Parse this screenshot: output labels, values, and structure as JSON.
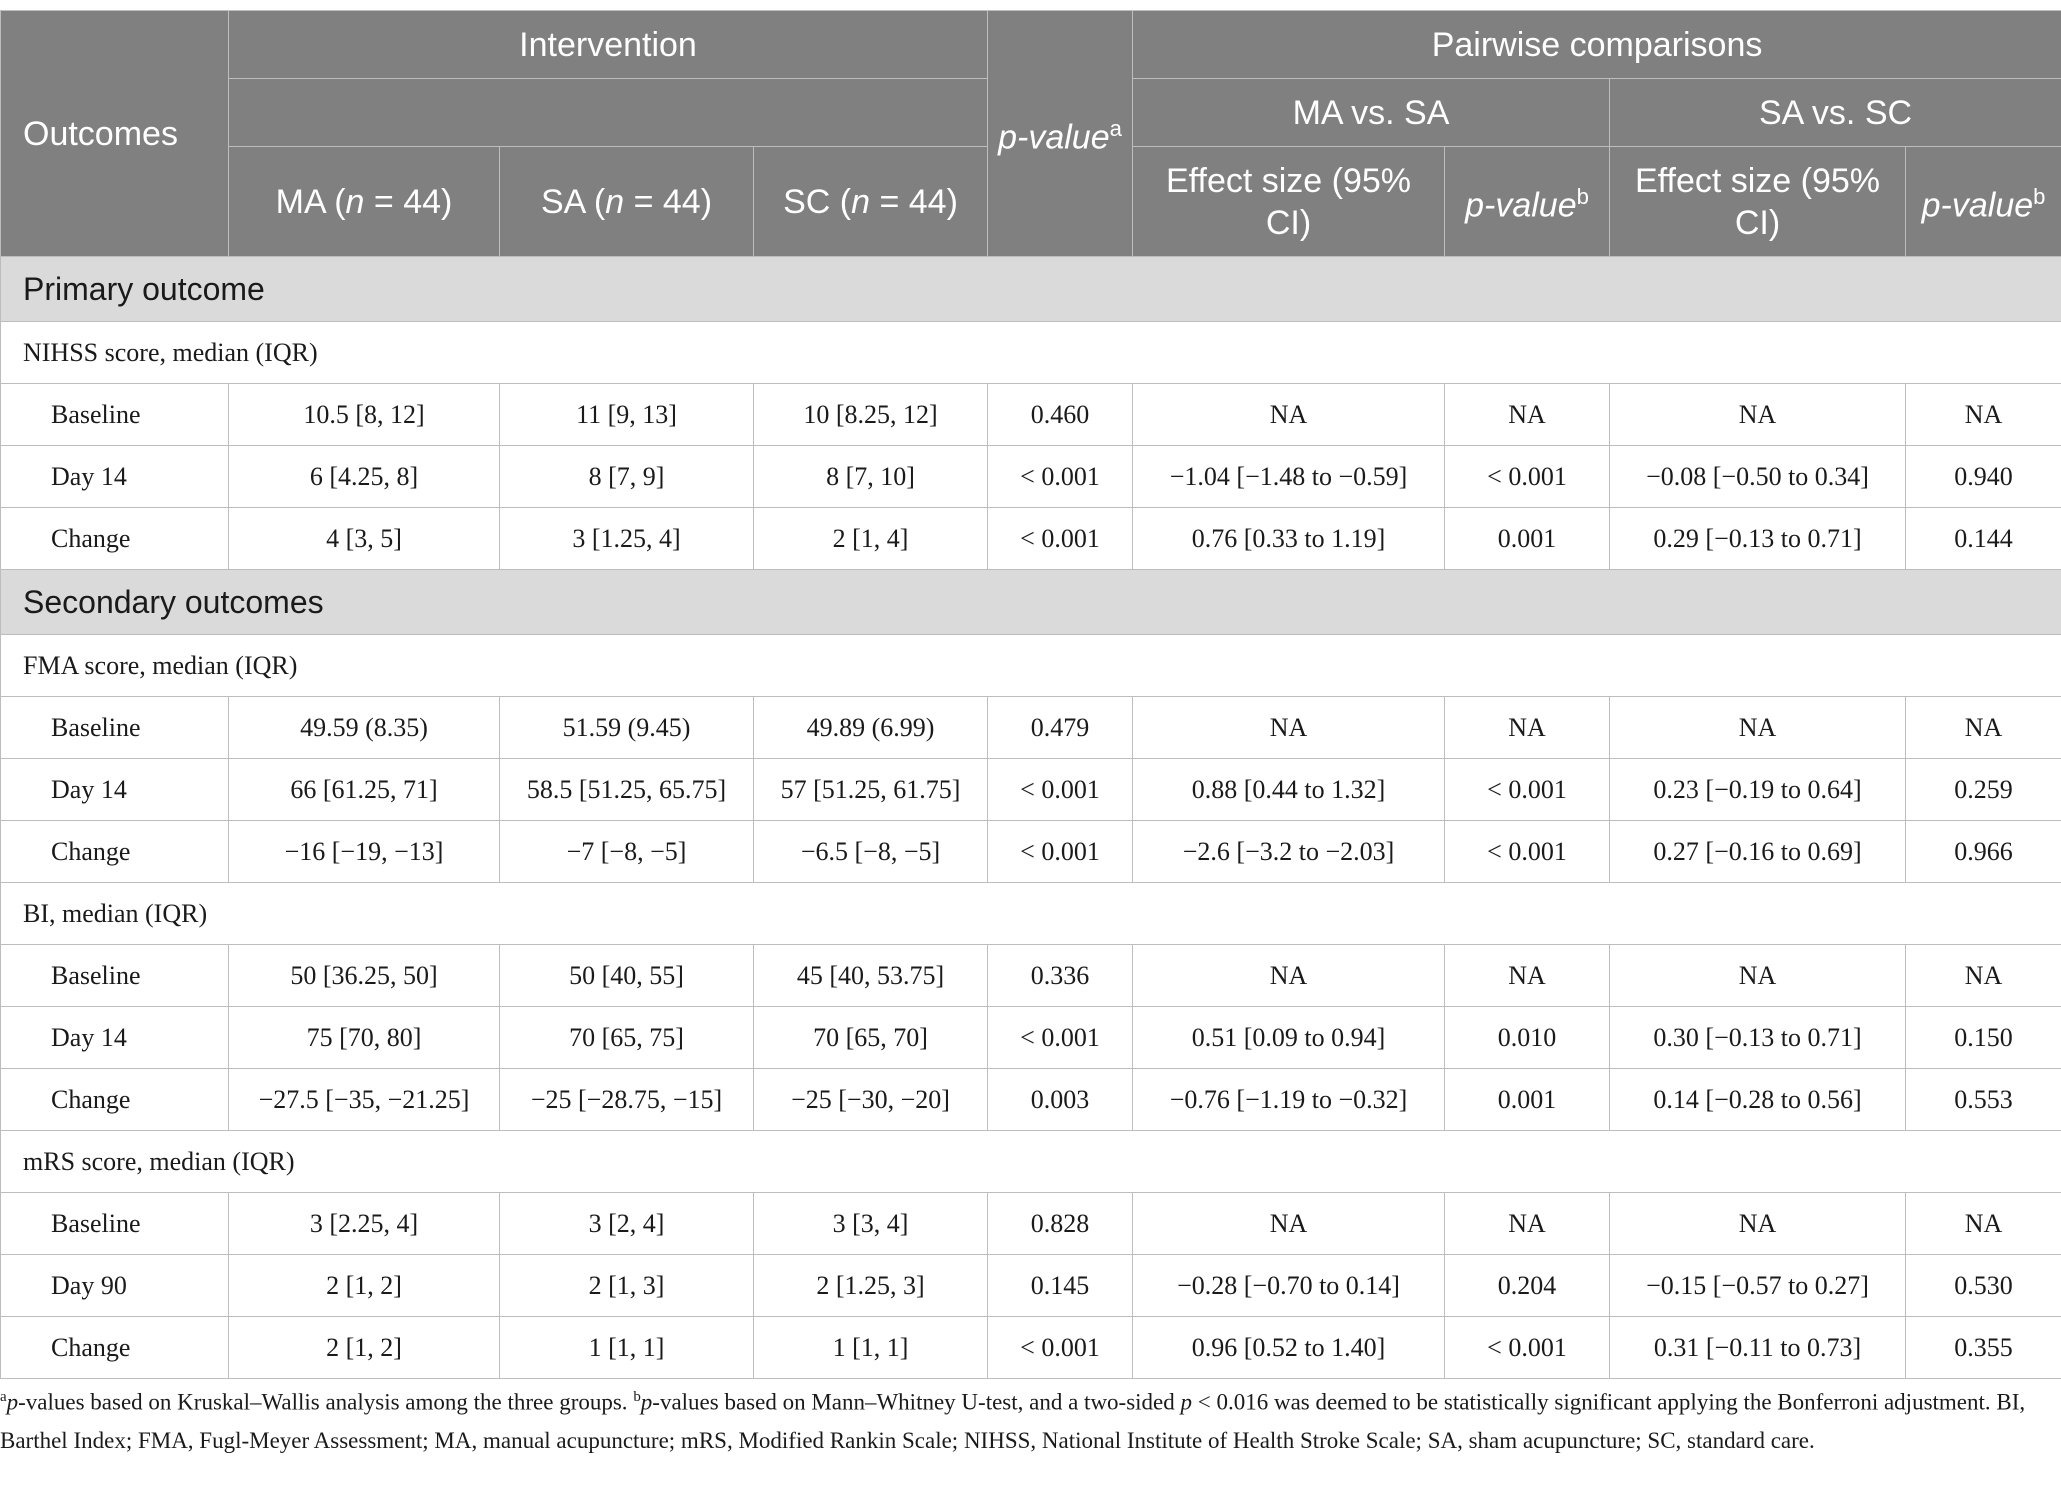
{
  "header": {
    "outcomes": "Outcomes",
    "intervention": "Intervention",
    "pvalue_a_text": "p-value",
    "pvalue_a_sup": "a",
    "pairwise": "Pairwise comparisons",
    "ma_vs_sa": "MA vs. SA",
    "sa_vs_sc": "SA vs. SC",
    "ma_col": {
      "name": "MA (",
      "n": "n",
      "rest": " = 44)"
    },
    "sa_col": {
      "name": "SA (",
      "n": "n",
      "rest": " = 44)"
    },
    "sc_col": {
      "name": "SC (",
      "n": "n",
      "rest": " = 44)"
    },
    "effect_size": "Effect size (95% CI)",
    "pvalue_b_text": "p-value",
    "pvalue_b_sup": "b"
  },
  "sections": {
    "primary": "Primary outcome",
    "secondary": "Secondary outcomes"
  },
  "groups": {
    "nihss": "NIHSS score, median (IQR)",
    "fma": "FMA score, median (IQR)",
    "bi": "BI, median (IQR)",
    "mrs": "mRS score, median (IQR)"
  },
  "rows": {
    "nihss": [
      [
        "Baseline",
        "10.5 [8, 12]",
        "11 [9, 13]",
        "10 [8.25, 12]",
        "0.460",
        "NA",
        "NA",
        "NA",
        "NA"
      ],
      [
        "Day 14",
        "6 [4.25, 8]",
        "8 [7, 9]",
        "8 [7, 10]",
        "< 0.001",
        "−1.04 [−1.48 to −0.59]",
        "< 0.001",
        "−0.08 [−0.50 to 0.34]",
        "0.940"
      ],
      [
        "Change",
        "4 [3, 5]",
        "3 [1.25, 4]",
        "2 [1, 4]",
        "< 0.001",
        "0.76 [0.33 to 1.19]",
        "0.001",
        "0.29 [−0.13 to 0.71]",
        "0.144"
      ]
    ],
    "fma": [
      [
        "Baseline",
        "49.59 (8.35)",
        "51.59 (9.45)",
        "49.89 (6.99)",
        "0.479",
        "NA",
        "NA",
        "NA",
        "NA"
      ],
      [
        "Day 14",
        "66 [61.25, 71]",
        "58.5 [51.25, 65.75]",
        "57 [51.25, 61.75]",
        "< 0.001",
        "0.88 [0.44 to 1.32]",
        "< 0.001",
        "0.23 [−0.19 to 0.64]",
        "0.259"
      ],
      [
        "Change",
        "−16 [−19, −13]",
        "−7 [−8, −5]",
        "−6.5 [−8, −5]",
        "< 0.001",
        "−2.6 [−3.2 to −2.03]",
        "< 0.001",
        "0.27 [−0.16 to 0.69]",
        "0.966"
      ]
    ],
    "bi": [
      [
        "Baseline",
        "50 [36.25, 50]",
        "50 [40, 55]",
        "45 [40, 53.75]",
        "0.336",
        "NA",
        "NA",
        "NA",
        "NA"
      ],
      [
        "Day 14",
        "75 [70, 80]",
        "70 [65, 75]",
        "70 [65, 70]",
        "< 0.001",
        "0.51 [0.09 to 0.94]",
        "0.010",
        "0.30 [−0.13 to 0.71]",
        "0.150"
      ],
      [
        "Change",
        "−27.5 [−35, −21.25]",
        "−25 [−28.75, −15]",
        "−25 [−30, −20]",
        "0.003",
        "−0.76 [−1.19 to −0.32]",
        "0.001",
        "0.14 [−0.28 to 0.56]",
        "0.553"
      ]
    ],
    "mrs": [
      [
        "Baseline",
        "3 [2.25, 4]",
        "3 [2, 4]",
        "3 [3, 4]",
        "0.828",
        "NA",
        "NA",
        "NA",
        "NA"
      ],
      [
        "Day 90",
        "2 [1, 2]",
        "2 [1, 3]",
        "2 [1.25, 3]",
        "0.145",
        "−0.28 [−0.70 to 0.14]",
        "0.204",
        "−0.15 [−0.57 to 0.27]",
        "0.530"
      ],
      [
        "Change",
        "2 [1, 2]",
        "1 [1, 1]",
        "1 [1, 1]",
        "< 0.001",
        "0.96 [0.52 to 1.40]",
        "< 0.001",
        "0.31 [−0.11 to 0.73]",
        "0.355"
      ]
    ]
  },
  "footnote": {
    "a_sup": "a",
    "a_italic": "p",
    "a_text": "-values based on Kruskal–Wallis analysis among the three groups. ",
    "b_sup": "b",
    "b_italic": "p",
    "b_text1": "-values based on Mann–Whitney U-test, and a two-sided ",
    "b_italic2": "p",
    "b_text2": " < 0.016 was deemed to be statistically significant applying the Bonferroni adjustment. BI, Barthel Index; FMA, Fugl-Meyer Assessment; MA, manual acupuncture; mRS, Modified Rankin Scale; NIHSS, National Institute of Health Stroke Scale; SA, sham acupuncture; SC, standard care."
  }
}
